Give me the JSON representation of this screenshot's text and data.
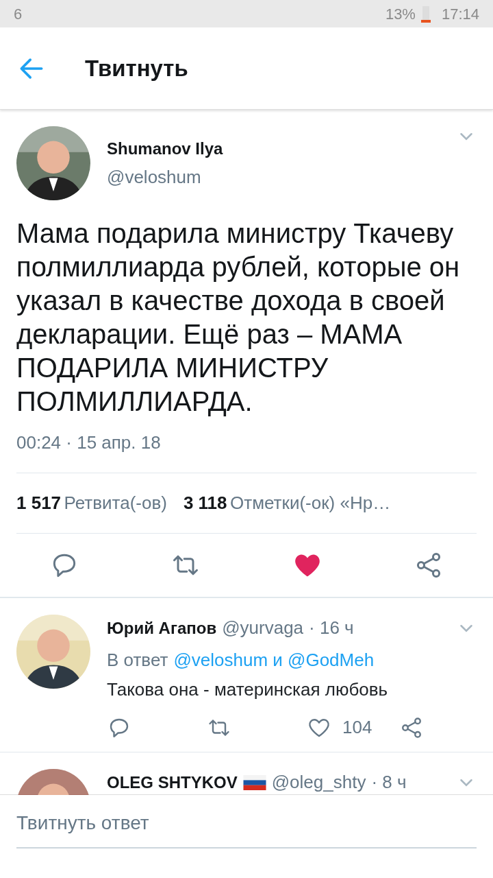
{
  "status_bar": {
    "notification_count": "6",
    "battery": "13%",
    "time": "17:14"
  },
  "header": {
    "title": "Твитнуть"
  },
  "tweet": {
    "name": "Shumanov Ilya",
    "handle": "@veloshum",
    "text": "Мама подарила министру Ткачеву полмиллиарда рублей, которые он указал в качестве дохода в своей декларации. Ещё раз – МАМА ПОДАРИЛА МИНИСТРУ ПОЛМИЛЛИАРДА.",
    "timestamp": "00:24 · 15 апр. 18",
    "stats": [
      {
        "count": "1 517",
        "label": "Ретвита(-ов)"
      },
      {
        "count": "3 118",
        "label": "Отметки(-ок) «Нр…"
      }
    ],
    "liked": true
  },
  "replies": [
    {
      "name": "Юрий Агапов",
      "handle": "@yurvaga",
      "time": "· 16 ч",
      "reply_prefix": "В ответ",
      "reply_to": "@veloshum и @GodMeh",
      "text": "Такова она - материнская любовь",
      "likes": "104",
      "liked": false
    },
    {
      "name": "OLEG SHTYKOV",
      "flag": true,
      "handle": "@oleg_shty",
      "time": "· 8 ч"
    }
  ],
  "compose": {
    "placeholder": "Твитнуть ответ"
  }
}
